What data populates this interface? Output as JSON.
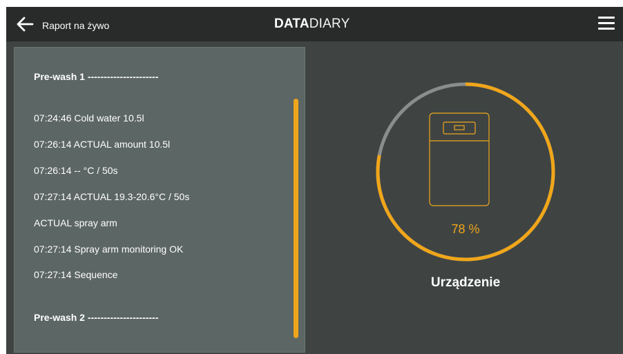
{
  "header": {
    "back_label": "Raport na żywo",
    "logo_bold": "DATA",
    "logo_light": "DIARY"
  },
  "log": {
    "entries": [
      {
        "text": "Pre-wash 1 ----------------------",
        "type": "section"
      },
      {
        "text": "07:24:46 Cold water 10.5l",
        "type": "line"
      },
      {
        "text": "07:26:14 ACTUAL amount 10.5l",
        "type": "line"
      },
      {
        "text": "07:26:14 -- °C / 50s",
        "type": "line"
      },
      {
        "text": "07:27:14 ACTUAL 19.3-20.6°C / 50s",
        "type": "line"
      },
      {
        "text": "ACTUAL spray arm",
        "type": "line"
      },
      {
        "text": "07:27:14 Spray arm monitoring OK",
        "type": "line"
      },
      {
        "text": "07:27:14 Sequence",
        "type": "line"
      },
      {
        "text": "Pre-wash 2 ----------------------",
        "type": "section"
      }
    ]
  },
  "gauge": {
    "progress": 0.78,
    "percent_text": "78 %",
    "label": "Urządzenie",
    "icon": "washing-machine-icon"
  },
  "colors": {
    "accent": "#f0a61a",
    "track": "#8a8d8c",
    "header_bg": "#292b2b",
    "content_bg": "#3f4443",
    "panel_bg": "#5c6664"
  }
}
